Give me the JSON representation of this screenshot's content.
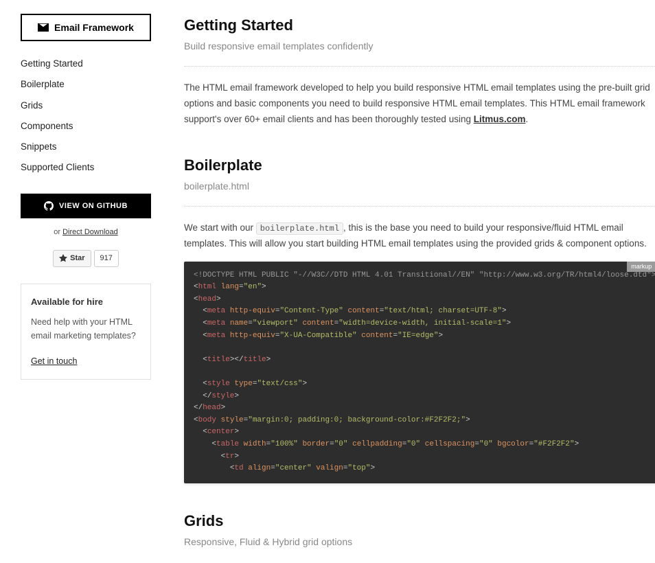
{
  "sidebar": {
    "logo_label": "Email Framework",
    "nav": [
      "Getting Started",
      "Boilerplate",
      "Grids",
      "Components",
      "Snippets",
      "Supported Clients"
    ],
    "github_btn": "VIEW ON GITHUB",
    "direct_download_prefix": "or ",
    "direct_download_link": "Direct Download",
    "star_label": "Star",
    "star_count": "917",
    "hire": {
      "title": "Available for hire",
      "body": "Need help with your HTML email marketing templates?",
      "link": "Get in touch"
    }
  },
  "sections": {
    "getting_started": {
      "title": "Getting Started",
      "subtitle": "Build responsive email templates confidently",
      "intro_before_link": "The HTML email framework developed to help you build responsive HTML email templates using the pre-built grid options and basic components you need to build responsive HTML email templates. This HTML email framework support's over 60+ email clients and has been thoroughly tested using ",
      "intro_link": "Litmus.com",
      "intro_after_link": "."
    },
    "boilerplate": {
      "title": "Boilerplate",
      "subtitle": "boilerplate.html",
      "body_before_code": "We start with our ",
      "body_inline_code": "boilerplate.html",
      "body_after_code": ", this is the base you need to build your responsive/fluid HTML email templates. This will allow you start building HTML email templates using the provided grids & component options.",
      "code_lang": "markup"
    },
    "grids": {
      "title": "Grids",
      "subtitle": "Responsive, Fluid & Hybrid grid options"
    }
  },
  "code": {
    "l1_doctype": "<!DOCTYPE HTML PUBLIC \"-//W3C//DTD HTML 4.01 Transitional//EN\" \"http://www.w3.org/TR/html4/loose.dtd\">",
    "l2_html_open": "<",
    "l2_html_tag": "html",
    "l2_lang_attr": " lang",
    "l2_eq": "=",
    "l2_lang_val": "\"en\"",
    "l2_close": ">",
    "l3_head_open": "<",
    "l3_head_tag": "head",
    "l3_close": ">",
    "l4_meta": "meta",
    "l4_httpequiv": " http-equiv",
    "l4_ct": "\"Content-Type\"",
    "l4_content_attr": " content",
    "l4_ct_val": "\"text/html; charset=UTF-8\"",
    "l5_name": " name",
    "l5_viewport": "\"viewport\"",
    "l5_vp_val": "\"width=device-width, initial-scale=1\"",
    "l6_xua": "\"X-UA-Compatible\"",
    "l6_ie": "\"IE=edge\"",
    "l8_title": "title",
    "l10_style": "style",
    "l10_type_attr": " type",
    "l10_type_val": "\"text/css\"",
    "l13_body": "body",
    "l13_style_attr": " style",
    "l13_style_val": "\"margin:0; padding:0; background-color:#F2F2F2;\"",
    "l14_center": "center",
    "l15_table": "table",
    "l15_width_attr": " width",
    "l15_width_val": "\"100%\"",
    "l15_border_attr": " border",
    "l15_zero": "\"0\"",
    "l15_cp_attr": " cellpadding",
    "l15_cs_attr": " cellspacing",
    "l15_bg_attr": " bgcolor",
    "l15_bg_val": "\"#F2F2F2\"",
    "l16_tr": "tr",
    "l17_td": "td",
    "l17_align_attr": " align",
    "l17_align_val": "\"center\"",
    "l17_valign_attr": " valign",
    "l17_valign_val": "\"top\""
  }
}
